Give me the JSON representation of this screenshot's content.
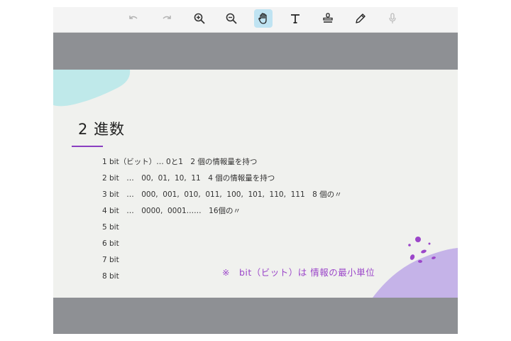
{
  "toolbar": {
    "tools": [
      {
        "name": "undo",
        "icon": "undo-icon",
        "state": "disabled"
      },
      {
        "name": "redo",
        "icon": "redo-icon",
        "state": "disabled"
      },
      {
        "name": "zoom-in",
        "icon": "zoom-in-icon",
        "state": "normal"
      },
      {
        "name": "zoom-out",
        "icon": "zoom-out-icon",
        "state": "normal"
      },
      {
        "name": "hand",
        "icon": "hand-icon",
        "state": "active"
      },
      {
        "name": "text",
        "icon": "text-icon",
        "state": "normal"
      },
      {
        "name": "stamp",
        "icon": "stamp-icon",
        "state": "normal"
      },
      {
        "name": "pen",
        "icon": "pen-icon",
        "state": "normal"
      },
      {
        "name": "mic",
        "icon": "mic-icon",
        "state": "disabled"
      }
    ]
  },
  "slide": {
    "title": "2 進数",
    "lines": [
      "1 bit（ビット）… 0と1　2 個の情報量を持つ",
      "2 bit　…　00,  01,  10,  11　4 個の情報量を持つ",
      "3 bit　…　000,  001,  010,  011,  100,  101,  110,  111　8 個の〃",
      "4 bit　…　0000,  0001……　16個の〃",
      "5 bit",
      "6 bit",
      "7 bit",
      "8 bit"
    ],
    "note": "※　bit（ビット）は 情報の最小単位"
  },
  "colors": {
    "accent_purple": "#9b46c9",
    "rule_purple": "#8a3fc1",
    "blob_teal": "#bfe9ea",
    "blob_lavender": "#c5b3e8",
    "active_tool": "#bfe3f2",
    "frame_gray": "#8e9094"
  }
}
